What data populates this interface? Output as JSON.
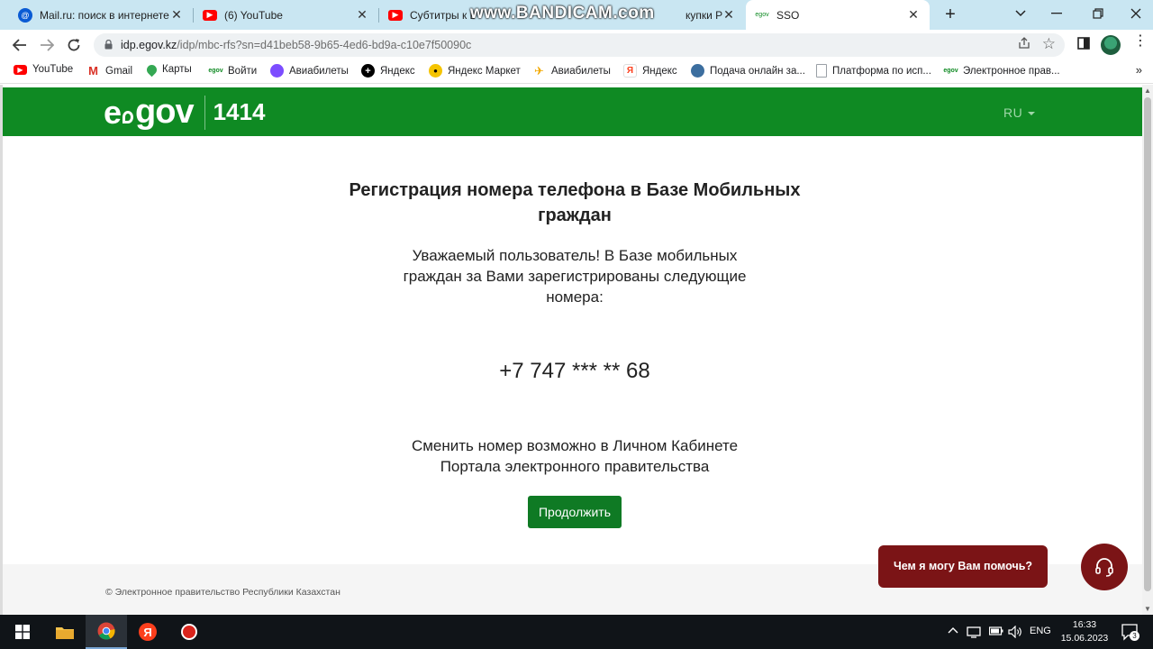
{
  "browser": {
    "tabs": [
      {
        "title": "Mail.ru: поиск в интернете",
        "icon": "mailru-icon",
        "color": "#0a5bd4"
      },
      {
        "title": "(6) YouTube",
        "icon": "youtube-icon",
        "color": "#ff0000"
      },
      {
        "title": "Субтитры к в",
        "title_tail": "купки Р",
        "icon": "youtube-icon",
        "color": "#ff0000"
      },
      {
        "title": "SSO",
        "icon": "egov-icon",
        "color": "#0f8a23",
        "active": true
      }
    ],
    "close_glyph": "✕",
    "new_tab_glyph": "+",
    "recording_watermark": "www.BANDICAM.com",
    "address": {
      "host": "idp.egov.kz",
      "path": "/idp/mbc-rfs?sn=d41beb58-9b65-4ed6-bd9a-c10e7f50090c"
    },
    "bookmarks": [
      {
        "label": "YouTube",
        "icon": "youtube-icon",
        "color": "#ff0000"
      },
      {
        "label": "Gmail",
        "icon": "gmail-icon",
        "color": "#d93025"
      },
      {
        "label": "Карты",
        "icon": "maps-icon",
        "color": "#34a853"
      },
      {
        "label": "Войти",
        "icon": "egov-icon",
        "color": "#0f8a23"
      },
      {
        "label": "Авиабилеты",
        "icon": "aviasales-icon",
        "color": "#7c4dff"
      },
      {
        "label": "Яндекс",
        "icon": "yandex-icon",
        "color": "#000000"
      },
      {
        "label": "Яндекс Маркет",
        "icon": "market-icon",
        "color": "#f5c400"
      },
      {
        "label": "Авиабилеты",
        "icon": "plane-icon",
        "color": "#f2a900"
      },
      {
        "label": "Яндекс",
        "icon": "yandex-icon",
        "color": "#fc3f1d"
      },
      {
        "label": "Подача онлайн за...",
        "icon": "globe-icon",
        "color": "#3c6e9f"
      },
      {
        "label": "Платформа по исп...",
        "icon": "page-icon",
        "color": "#9aa0a6"
      },
      {
        "label": "Электронное прав...",
        "icon": "egov-icon",
        "color": "#0f8a23"
      }
    ]
  },
  "header": {
    "logo_e": "e",
    "logo_gov": "gov",
    "logo_number": "1414",
    "language": "RU",
    "brand_color": "#0f8a23"
  },
  "main": {
    "title": "Регистрация номера телефона в Базе Мобильных граждан",
    "notice": "Уважаемый пользователь! В Базе мобильных граждан за Вами зарегистрированы следующие номера:",
    "phone": "+7 747 *** ** 68",
    "change_info": "Сменить номер возможно в Личном Кабинете Портала электронного правительства",
    "continue_label": "Продолжить",
    "button_color": "#0f7a24"
  },
  "footer": {
    "copyright": "© Электронное правительство Республики Казахстан"
  },
  "chat": {
    "prompt": "Чем я могу Вам помочь?",
    "color": "#7b1416"
  },
  "taskbar": {
    "language": "ENG",
    "time": "16:33",
    "date": "15.06.2023",
    "notifications": "3"
  }
}
